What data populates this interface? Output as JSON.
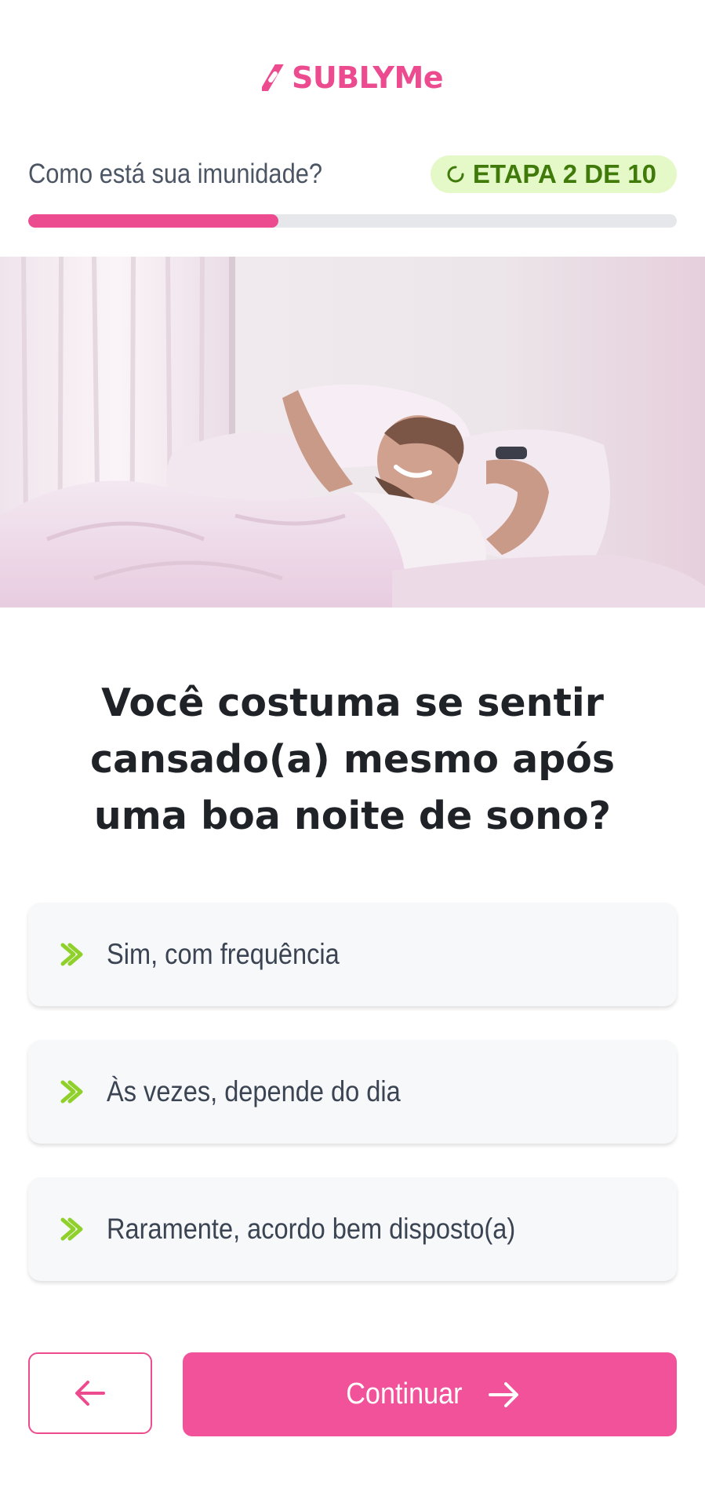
{
  "brand": {
    "name": "SUBLYMe",
    "color": "#ec4c8f"
  },
  "step": {
    "question": "Como está sua imunidade?",
    "badge": "ETAPA 2 DE 10",
    "badge_icon": "spinner-icon",
    "progress_fraction": 0.386
  },
  "hero": {
    "alt": "Homem sorrindo espreguiçando na cama"
  },
  "question": "Você costuma se sentir cansado(a) mesmo após uma boa noite de sono?",
  "options": [
    {
      "label": "Sim, com frequência",
      "icon": "chevron-double-right-icon"
    },
    {
      "label": "Às vezes, depende do dia",
      "icon": "chevron-double-right-icon"
    },
    {
      "label": "Raramente, acordo bem disposto(a)",
      "icon": "chevron-double-right-icon"
    }
  ],
  "nav": {
    "back_icon": "arrow-left-icon",
    "continue_label": "Continuar",
    "continue_icon": "arrow-right-icon"
  },
  "colors": {
    "accent": "#ec4c8f",
    "badge_bg": "#e5f9c8",
    "badge_text": "#3f7a0a",
    "chevron": "#8fd12a"
  }
}
